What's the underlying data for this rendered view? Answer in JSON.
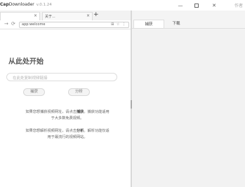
{
  "app": {
    "title_prefix": "Cap",
    "title_rest": "Downloader",
    "version": "v.0.1.24",
    "help_label": "作者"
  },
  "window_controls": {
    "minimize": "—",
    "close": "✕"
  },
  "tabs": [
    {
      "label": "",
      "close": "×"
    },
    {
      "label": "关于...",
      "close": "×"
    }
  ],
  "new_tab_label": "+",
  "navbar": {
    "forward": "→",
    "reload": "⟳",
    "url": "app:welcome",
    "url_icons": "⊞ ☆ ⋮"
  },
  "welcome": {
    "heading": "从此处开始",
    "input_placeholder": "在此处复制视频链接",
    "capture_button": "捕获",
    "analyze_button": "分析",
    "tip1_a": "如果您想捕获视频网址，请点击",
    "tip1_kw": "捕获",
    "tip1_b": "。捕获功能适用",
    "tip1_c": "于大多数免费视频。",
    "tip2_a": "如果您想解析视频网址，请点击",
    "tip2_kw": "分析",
    "tip2_b": "。解析功能仅适",
    "tip2_c": "用于最流行的视频网站。"
  },
  "right_panel": {
    "tabs": [
      "捕获",
      "下载"
    ]
  }
}
